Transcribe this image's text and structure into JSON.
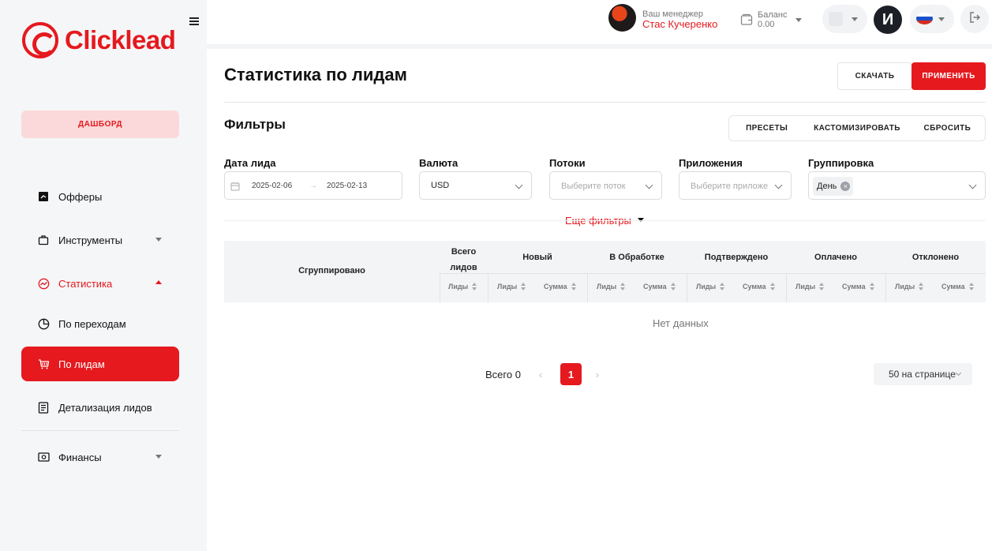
{
  "brand": {
    "logo_text": "Clicklead",
    "accent": "#e5191e"
  },
  "sidebar": {
    "dashboard_label": "ДАШБОРД",
    "items": [
      {
        "label": "Офферы",
        "icon": "offers-icon"
      },
      {
        "label": "Инструменты",
        "icon": "briefcase-icon"
      },
      {
        "label": "Статистика",
        "icon": "statistics-icon"
      },
      {
        "label": "По переходам",
        "icon": "pie-chart-icon"
      },
      {
        "label": "По лидам",
        "icon": "cart-icon"
      },
      {
        "label": "Детализация лидов",
        "icon": "document-icon"
      },
      {
        "label": "Финансы",
        "icon": "wallet-icon"
      }
    ]
  },
  "header": {
    "manager_label": "Ваш менеджер",
    "manager_name": "Стас Кучеренко",
    "balance_label": "Баланс",
    "balance_value": "0.00",
    "user_initial": "И",
    "language": "ru"
  },
  "page": {
    "title": "Статистика по лидам",
    "download_label": "СКАЧАТЬ",
    "apply_label": "ПРИМЕНИТЬ"
  },
  "filters": {
    "title": "Фильтры",
    "presets_label": "ПРЕСЕТЫ",
    "customize_label": "КАСТОМИЗИРОВАТЬ",
    "reset_label": "СБРОСИТЬ",
    "date_label": "Дата лида",
    "date_from": "2025-02-06",
    "date_sep": "→",
    "date_to": "2025-02-13",
    "currency_label": "Валюта",
    "currency_value": "USD",
    "streams_label": "Потоки",
    "streams_placeholder": "Выберите поток",
    "apps_label": "Приложения",
    "apps_placeholder": "Выберите приложе",
    "grouping_label": "Группировка",
    "grouping_tag": "День",
    "more_filters": "Еще фильтры"
  },
  "table": {
    "grouped": "Сгруппировано",
    "total_leads_line1": "Всего",
    "total_leads_line2": "лидов",
    "groups": [
      "Новый",
      "В Обработке",
      "Подтверждено",
      "Оплачено",
      "Отклонено"
    ],
    "sub_leads": "Лиды",
    "sub_sum": "Сумма",
    "empty": "Нет данных"
  },
  "pagination": {
    "total": "Всего 0",
    "current": "1",
    "per_page": "50 на странице"
  }
}
